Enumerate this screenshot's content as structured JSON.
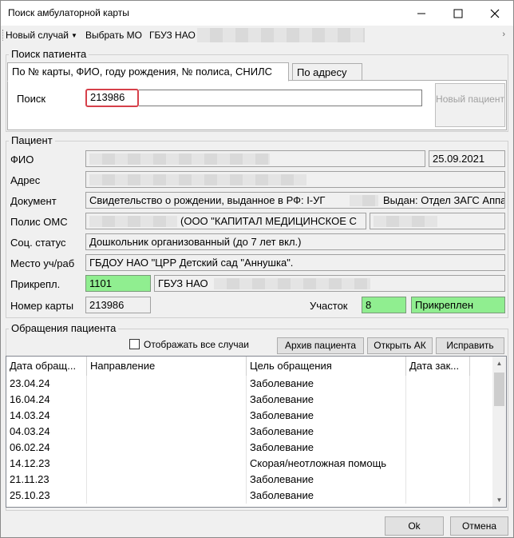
{
  "window": {
    "title": "Поиск амбулаторной карты"
  },
  "icons": {
    "minimize": "minimize-icon",
    "maximize": "maximize-icon",
    "close": "close-icon"
  },
  "toolbar": {
    "new_case": "Новый случай",
    "select_mo": "Выбрать МО",
    "mo_name": "ГБУЗ НАО"
  },
  "search": {
    "group_label": "Поиск патиента",
    "tabs": [
      {
        "label": "По № карты, ФИО, году рождения, № полиса, СНИЛС",
        "active": true
      },
      {
        "label": "По адресу",
        "active": false
      }
    ],
    "label": "Поиск",
    "value": "213986",
    "new_patient_label": "Новый пациент"
  },
  "patient": {
    "group_label": "Пациент",
    "fio_label": "ФИО",
    "birth_date": "25.09.2021",
    "address_label": "Адрес",
    "document_label": "Документ",
    "document_value": "Свидетельство о рождении, выданное в РФ: I-УГ",
    "document_issued": "Выдан: Отдел ЗАГС Аппа",
    "oms_label": "Полис ОМС",
    "oms_company": "(ООО \"КАПИТАЛ МЕДИЦИНСКОЕ С",
    "social_label": "Соц. статус",
    "social_value": "Дошкольник организованный (до 7 лет вкл.)",
    "workplace_label": "Место уч/раб",
    "workplace_value": "ГБДОУ НАО \"ЦРР  Детский сад \"Аннушка\".",
    "attach_label": "Прикрепл.",
    "attach_code": "1101",
    "attach_org": "ГБУЗ НАО",
    "card_label": "Номер карты",
    "card_value": "213986",
    "district_label": "Участок",
    "district_value": "8",
    "status_value": "Прикреплен"
  },
  "visits": {
    "group_label": "Обращения пациента",
    "show_all_label": "Отображать все случаи",
    "show_all_checked": false,
    "archive_button": "Архив пациента",
    "open_button": "Открыть АК",
    "fix_button": "Исправить",
    "columns": [
      "Дата обращ...",
      "Направление",
      "Цель обращения",
      "Дата зак..."
    ],
    "rows": [
      {
        "date": "23.04.24",
        "direction": "",
        "purpose": "Заболевание",
        "closed": ""
      },
      {
        "date": "16.04.24",
        "direction": "",
        "purpose": "Заболевание",
        "closed": ""
      },
      {
        "date": "14.03.24",
        "direction": "",
        "purpose": "Заболевание",
        "closed": ""
      },
      {
        "date": "04.03.24",
        "direction": "",
        "purpose": "Заболевание",
        "closed": ""
      },
      {
        "date": "06.02.24",
        "direction": "",
        "purpose": "Заболевание",
        "closed": ""
      },
      {
        "date": "14.12.23",
        "direction": "",
        "purpose": "Скорая/неотложная помощь",
        "closed": ""
      },
      {
        "date": "21.11.23",
        "direction": "",
        "purpose": "Заболевание",
        "closed": ""
      },
      {
        "date": "25.10.23",
        "direction": "",
        "purpose": "Заболевание",
        "closed": ""
      }
    ]
  },
  "footer": {
    "ok": "Ok",
    "cancel": "Отмена"
  }
}
